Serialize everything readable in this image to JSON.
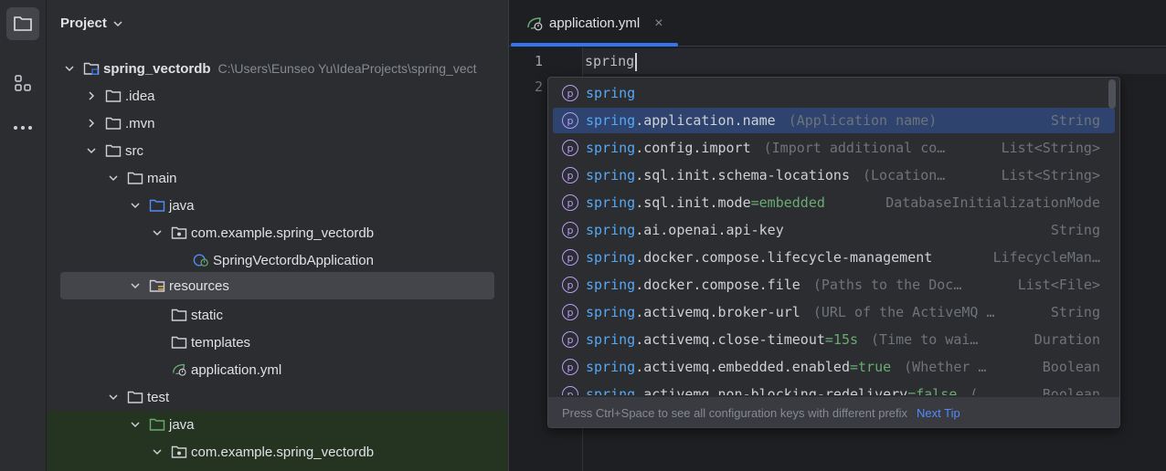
{
  "sidebar": {
    "project_label": "Project"
  },
  "tree": {
    "root": {
      "name": "spring_vectordb",
      "path": "C:\\Users\\Eunseo Yu\\IdeaProjects\\spring_vect"
    },
    "items": [
      {
        "label": ".idea"
      },
      {
        "label": ".mvn"
      },
      {
        "label": "src"
      },
      {
        "label": "main"
      },
      {
        "label": "java"
      },
      {
        "label": "com.example.spring_vectordb"
      },
      {
        "label": "SpringVectordbApplication"
      },
      {
        "label": "resources"
      },
      {
        "label": "static"
      },
      {
        "label": "templates"
      },
      {
        "label": "application.yml"
      },
      {
        "label": "test"
      },
      {
        "label": "java"
      },
      {
        "label": "com.example.spring_vectordb"
      }
    ]
  },
  "editor": {
    "tab_label": "application.yml",
    "close_glyph": "×",
    "line_numbers": [
      "1",
      "2"
    ],
    "code": "spring"
  },
  "completion": {
    "items": [
      {
        "match": "spring",
        "rest": "",
        "value": "",
        "hint": "",
        "type": ""
      },
      {
        "match": "spring",
        "rest": ".application.name",
        "value": "",
        "hint": "(Application name)",
        "type": "String"
      },
      {
        "match": "spring",
        "rest": ".config.import",
        "value": "",
        "hint": "(Import additional co…",
        "type": "List<String>"
      },
      {
        "match": "spring",
        "rest": ".sql.init.schema-locations",
        "value": "",
        "hint": "(Location…",
        "type": "List<String>"
      },
      {
        "match": "spring",
        "rest": ".sql.init.mode",
        "value": "=embedded",
        "hint": "",
        "type": "DatabaseInitializationMode"
      },
      {
        "match": "spring",
        "rest": ".ai.openai.api-key",
        "value": "",
        "hint": "",
        "type": "String"
      },
      {
        "match": "spring",
        "rest": ".docker.compose.lifecycle-management",
        "value": "",
        "hint": "",
        "type": "LifecycleMan…"
      },
      {
        "match": "spring",
        "rest": ".docker.compose.file",
        "value": "",
        "hint": "(Paths to the Doc…",
        "type": "List<File>"
      },
      {
        "match": "spring",
        "rest": ".activemq.broker-url",
        "value": "",
        "hint": "(URL of the ActiveMQ …",
        "type": "String"
      },
      {
        "match": "spring",
        "rest": ".activemq.close-timeout",
        "value": "=15s",
        "hint": "(Time to wai…",
        "type": "Duration"
      },
      {
        "match": "spring",
        "rest": ".activemq.embedded.enabled",
        "value": "=true",
        "hint": "(Whether …",
        "type": "Boolean"
      },
      {
        "match": "spring",
        "rest": ".activemq.non-blocking-redelivery",
        "value": "=false",
        "hint": "(…",
        "type": "Boolean"
      }
    ],
    "footer_text": "Press Ctrl+Space to see all configuration keys with different prefix",
    "next_tip": "Next Tip",
    "badge": "p"
  },
  "colors": {
    "accent": "#3574f0",
    "match": "#56a8f5",
    "selection": "#2e436e"
  }
}
